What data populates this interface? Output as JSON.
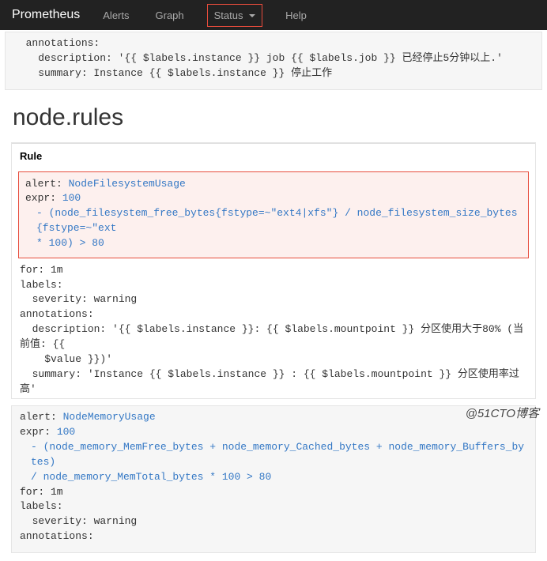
{
  "nav": {
    "brand": "Prometheus",
    "alerts": "Alerts",
    "graph": "Graph",
    "status": "Status",
    "help": "Help"
  },
  "top_block": {
    "line1": "  annotations:",
    "line2": "    description: '{{ $labels.instance }} job {{ $labels.job }} 已经停止5分钟以上.'",
    "line3": "    summary: Instance {{ $labels.instance }} 停止工作"
  },
  "page_title": "node.rules",
  "rule_label": "Rule",
  "rule1": {
    "alert_kw": "alert: ",
    "alert_name": "NodeFilesystemUsage",
    "expr_kw": "expr: ",
    "expr_val": "100",
    "expr_line1": "- (node_filesystem_free_bytes{fstype=~\"ext4|xfs\"} / node_filesystem_size_bytes{fstype=~\"ext",
    "expr_line2": "* 100) > 80",
    "tail_for": "for: 1m",
    "tail_labels": "labels:",
    "tail_sev": "  severity: warning",
    "tail_ann": "annotations:",
    "tail_desc1": "  description: '{{ $labels.instance }}: {{ $labels.mountpoint }} 分区使用大于80% (当前值: {{",
    "tail_desc2": "    $value }})'",
    "tail_sum": "  summary: 'Instance {{ $labels.instance }} : {{ $labels.mountpoint }} 分区使用率过高'"
  },
  "rule2": {
    "alert_kw": "alert: ",
    "alert_name": "NodeMemoryUsage",
    "expr_kw": "expr: ",
    "expr_val": "100",
    "expr_line1": "- (node_memory_MemFree_bytes + node_memory_Cached_bytes + node_memory_Buffers_bytes)",
    "expr_line2": "/ node_memory_MemTotal_bytes * 100 > 80",
    "tail_for": "for: 1m",
    "tail_labels": "labels:",
    "tail_sev": "  severity: warning",
    "tail_ann": "annotations:"
  },
  "watermark": "@51CTO博客"
}
